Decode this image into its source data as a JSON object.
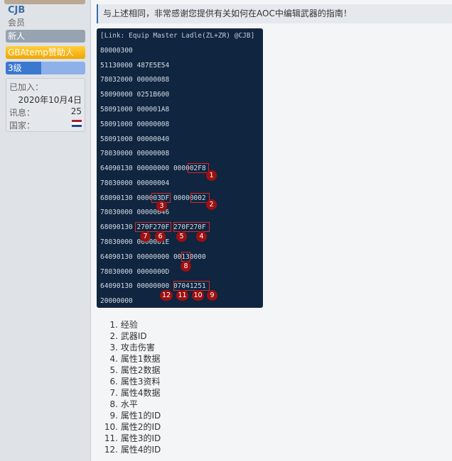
{
  "user": {
    "name": "CJB",
    "title": "会员",
    "ranks": [
      "新人",
      "GBAtemp赞助人",
      "3级"
    ],
    "level_progress_percent": 45,
    "joined_label": "已加入：",
    "joined_date": "2020年10月4日",
    "messages_label": "讯息：",
    "messages_count": "25",
    "country_label": "国家：",
    "country_flag": "netherlands-flag-icon"
  },
  "post": {
    "quote_text": "与上述相同，非常感谢您提供有关如何在AOC中编辑武器的指南！",
    "code_image": {
      "header": "[Link: Equip Master Ladle(ZL+ZR) @CJB]",
      "lines": [
        "80000300",
        "51130000 487E5E54",
        "78032000 00000088",
        "58090000 0251B600",
        "58091000 000001A8",
        "58091000 00000008",
        "58091000 00000040",
        "78030000 00000008",
        "64090130 00000000 000002F8",
        "78030000 00000004",
        "68090130 000003DF 00000002",
        "78030000 00000046",
        "68090130 270F270F 270F270F",
        "78030000 0000001E",
        "64090130 00000000 00130000",
        "78030000 0000000D",
        "64090130 00000000 07041251",
        "20000000"
      ],
      "badges": [
        "1",
        "2",
        "3",
        "4",
        "5",
        "6",
        "7",
        "8",
        "9",
        "10",
        "11",
        "12"
      ]
    },
    "legend": [
      {
        "num": "1.",
        "text": "经验"
      },
      {
        "num": "2.",
        "text": "武器ID"
      },
      {
        "num": "3.",
        "text": "攻击伤害"
      },
      {
        "num": "4.",
        "text": "属性1数据"
      },
      {
        "num": "5.",
        "text": "属性2数据"
      },
      {
        "num": "6.",
        "text": "属性3资料"
      },
      {
        "num": "7.",
        "text": "属性4数据"
      },
      {
        "num": "8.",
        "text": "水平"
      },
      {
        "num": "9.",
        "text": "属性1的ID"
      },
      {
        "num": "10.",
        "text": "属性2的ID"
      },
      {
        "num": "11.",
        "text": "属性3的ID"
      },
      {
        "num": "12.",
        "text": "属性4的ID"
      }
    ]
  }
}
